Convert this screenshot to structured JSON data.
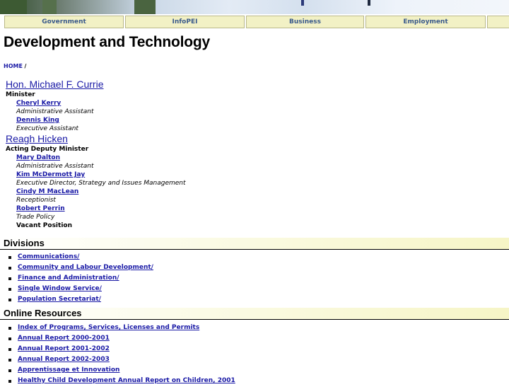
{
  "nav": {
    "tabs": [
      {
        "label": "Government"
      },
      {
        "label": "InfoPEI"
      },
      {
        "label": "Business"
      },
      {
        "label": "Employment"
      },
      {
        "label": ""
      }
    ]
  },
  "page": {
    "title": "Development and Technology",
    "breadcrumb": {
      "home": "HOME",
      "separator": "/"
    }
  },
  "org": {
    "minister": {
      "name": "Hon. Michael F. Currie",
      "role": "Minister"
    },
    "minister_staff": [
      {
        "name": "Cheryl Kerry",
        "title": "Administrative Assistant"
      },
      {
        "name": "Dennis King",
        "title": "Executive Assistant"
      }
    ],
    "deputy": {
      "name": "Reagh Hicken",
      "role": "Acting Deputy Minister"
    },
    "deputy_staff": [
      {
        "name": "Mary Dalton",
        "title": "Administrative Assistant"
      },
      {
        "name": "Kim McDermott Jay",
        "title": "Executive Director, Strategy and Issues Management"
      },
      {
        "name": "Cindy M MacLean",
        "title": "Receptionist"
      },
      {
        "name": "Robert Perrin",
        "title": "Trade Policy"
      }
    ],
    "vacant": "Vacant Position"
  },
  "divisions": {
    "heading": "Divisions",
    "items": [
      {
        "label": "Communications/"
      },
      {
        "label": "Community and Labour Development/"
      },
      {
        "label": "Finance and Administration/"
      },
      {
        "label": "Single Window Service/"
      },
      {
        "label": "Population Secretariat/"
      }
    ]
  },
  "online_resources": {
    "heading": "Online Resources",
    "items": [
      {
        "label": "Index of Programs, Services, Licenses and Permits"
      },
      {
        "label": "Annual Report 2000-2001"
      },
      {
        "label": "Annual Report 2001-2002"
      },
      {
        "label": "Annual Report 2002-2003"
      },
      {
        "label": "Apprentissage et Innovation"
      },
      {
        "label": "Healthy Child Development Annual Report on Children, 2001"
      }
    ]
  },
  "colors": {
    "link": "#1a1aa6",
    "tab_bg": "#f2f1c5",
    "tab_text": "#3a5a8c",
    "section_band": "#f6f5c6"
  }
}
